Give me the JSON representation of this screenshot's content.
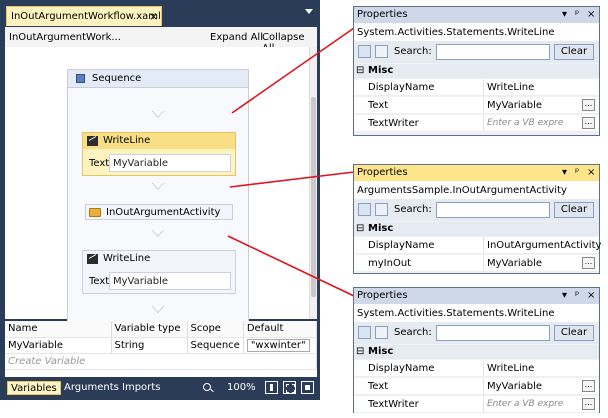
{
  "designer": {
    "tab_title": "InOutArgumentWorkflow.xaml",
    "tab_close": "×",
    "breadcrumb": "InOutArgumentWork...",
    "expand_all": "Expand All",
    "collapse_all": "Collapse All",
    "sequence_label": "Sequence",
    "writeline1": {
      "title": "WriteLine",
      "field_label": "Text",
      "field_value": "MyVariable"
    },
    "custom_activity": {
      "title": "InOutArgumentActivity"
    },
    "writeline2": {
      "title": "WriteLine",
      "field_label": "Text",
      "field_value": "MyVariable"
    }
  },
  "variables": {
    "headers": [
      "Name",
      "Variable type",
      "Scope",
      "Default"
    ],
    "rows": [
      {
        "name": "MyVariable",
        "type": "String",
        "scope": "Sequence",
        "default": "\"wxwinter\""
      }
    ],
    "create_label": "Create Variable"
  },
  "bottom_bar": {
    "tabs": [
      "Variables",
      "Arguments",
      "Imports"
    ],
    "zoom": "100%"
  },
  "properties": [
    {
      "title": "Properties",
      "type": "System.Activities.Statements.WriteLine",
      "search_label": "Search:",
      "clear_label": "Clear",
      "category": "Misc",
      "rows": [
        {
          "name": "DisplayName",
          "value": "WriteLine",
          "hint": false,
          "ellipsis": false
        },
        {
          "name": "Text",
          "value": "MyVariable",
          "hint": false,
          "ellipsis": true
        },
        {
          "name": "TextWriter",
          "value": "Enter a VB expre",
          "hint": true,
          "ellipsis": true
        }
      ]
    },
    {
      "title": "Properties",
      "type": "ArgumentsSample.InOutArgumentActivity",
      "search_label": "Search:",
      "clear_label": "Clear",
      "category": "Misc",
      "rows": [
        {
          "name": "DisplayName",
          "value": "InOutArgumentActivity",
          "hint": false,
          "ellipsis": false
        },
        {
          "name": "myInOut",
          "value": "MyVariable",
          "hint": false,
          "ellipsis": true
        }
      ]
    },
    {
      "title": "Properties",
      "type": "System.Activities.Statements.WriteLine",
      "search_label": "Search:",
      "clear_label": "Clear",
      "category": "Misc",
      "rows": [
        {
          "name": "DisplayName",
          "value": "WriteLine",
          "hint": false,
          "ellipsis": false
        },
        {
          "name": "Text",
          "value": "MyVariable",
          "hint": false,
          "ellipsis": true
        },
        {
          "name": "TextWriter",
          "value": "Enter a VB expre",
          "hint": true,
          "ellipsis": true
        }
      ]
    }
  ],
  "panel_controls": {
    "pin": "ᵖ",
    "dropdown": "▾",
    "close": "×",
    "expand": "⊟",
    "ellipsis": "..."
  },
  "colors": {
    "accent": "#fde68a",
    "frame": "#2b3c59",
    "connector": "#e0141e"
  }
}
